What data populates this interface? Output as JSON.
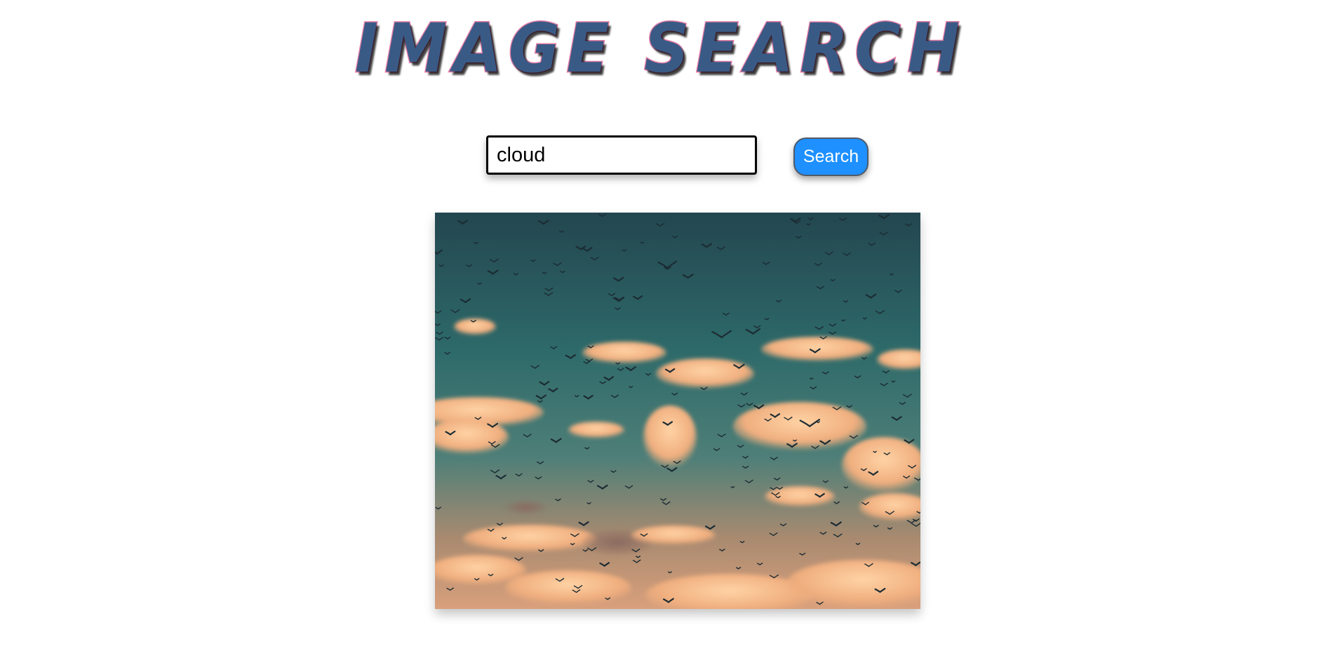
{
  "page": {
    "title": "IMAGE SEARCH"
  },
  "search": {
    "value": "cloud",
    "button_label": "Search"
  },
  "colors": {
    "title_fill": "#3a5a86",
    "title_outline": "#e97fa6",
    "button_bg": "#1e90ff",
    "button_text": "#ffffff"
  },
  "results": [
    {
      "subject": "sky with clouds and flock of birds at sunset"
    }
  ]
}
